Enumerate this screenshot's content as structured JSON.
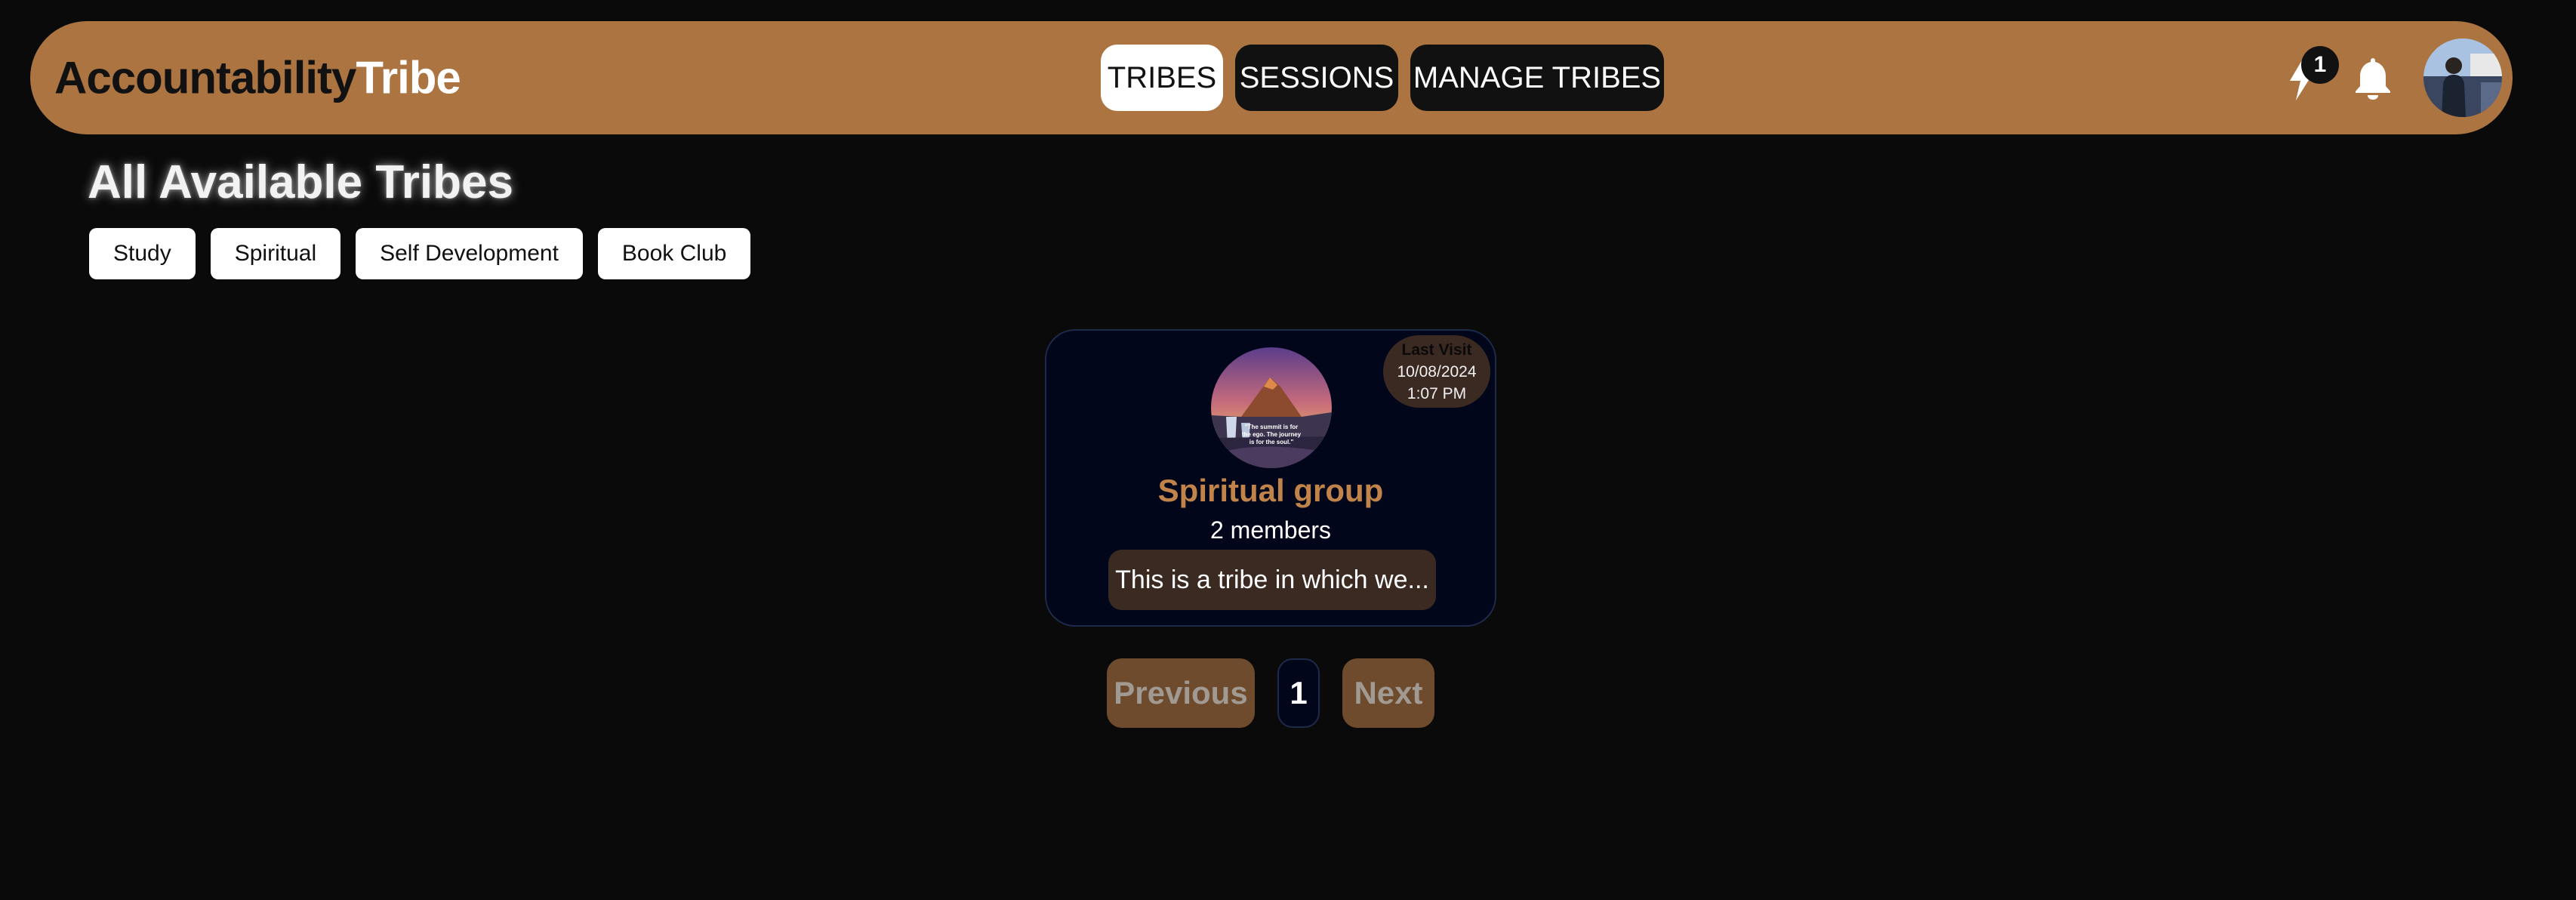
{
  "header": {
    "brand_part1": "Accountability",
    "brand_part2": "Tribe",
    "nav": {
      "tribes": "TRIBES",
      "sessions": "SESSIONS",
      "manage": "MANAGE TRIBES"
    },
    "streak_count": "1"
  },
  "main": {
    "title": "All Available Tribes",
    "categories": [
      "Study",
      "Spiritual",
      "Self Development",
      "Book Club"
    ]
  },
  "tribe_card": {
    "last_visit_label": "Last Visit",
    "last_visit_date": "10/08/2024",
    "last_visit_time": "1:07 PM",
    "image_quote": "\"The summit is for the ego. The journey is for the soul.\"",
    "name": "Spiritual group",
    "members": "2 members",
    "description": "This is a tribe in which we..."
  },
  "pagination": {
    "previous": "Previous",
    "page": "1",
    "next": "Next"
  },
  "colors": {
    "navbar": "#ac7441",
    "background": "#0a0a0a",
    "card_bg": "#02061a",
    "tribe_name": "#c0834a",
    "pill_bg": "#3b2a22",
    "pagination_btn": "#6e4b2d"
  },
  "icons": {
    "streak": "lightning-bolt-icon",
    "notifications": "bell-icon"
  }
}
